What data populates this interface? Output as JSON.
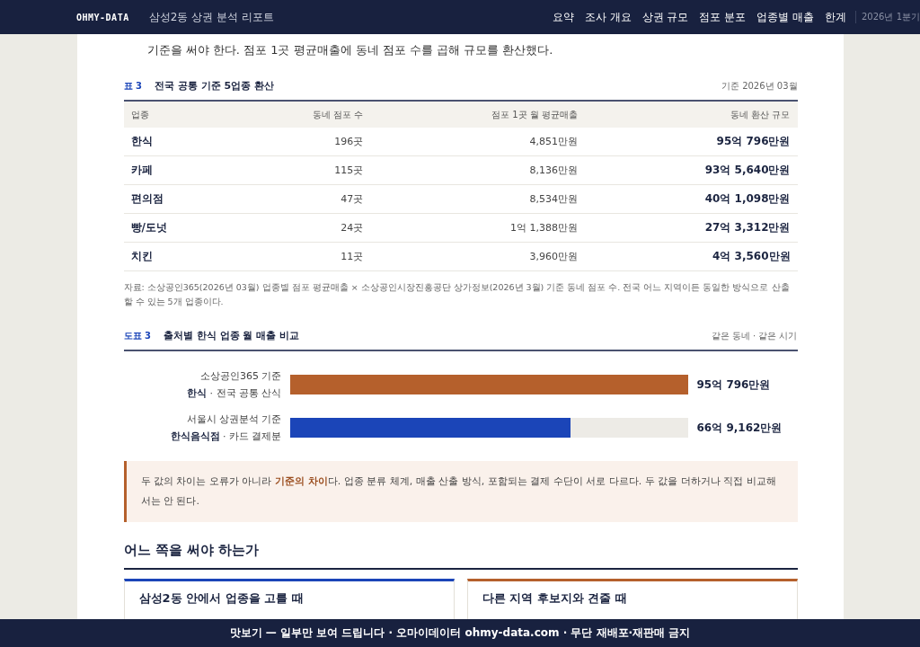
{
  "header": {
    "logo": "OHMY-DATA",
    "title": "삼성2동 상권 분석 리포트",
    "nav": [
      {
        "label": "요약",
        "selected": false
      },
      {
        "label": "조사 개요",
        "selected": false
      },
      {
        "label": "상권 규모",
        "selected": false
      },
      {
        "label": "점포 분포",
        "selected": false
      },
      {
        "label": "업종별 매출",
        "selected": false
      },
      {
        "label": "한계",
        "selected": false
      }
    ],
    "period": "2026년 1분기"
  },
  "intro": "기준을 써야 한다. 점포 1곳 평균매출에 동네 점포 수를 곱해 규모를 환산했다.",
  "table": {
    "tag": "표 3",
    "title": "전국 공통 기준 5업종 환산",
    "meta": "기준 2026년 03월",
    "columns": [
      "업종",
      "동네 점포 수",
      "점포 1곳 월 평균매출",
      "동네 환산 규모"
    ],
    "rows": [
      [
        "한식",
        "196곳",
        "4,851만원",
        "95억 796만원"
      ],
      [
        "카페",
        "115곳",
        "8,136만원",
        "93억 5,640만원"
      ],
      [
        "편의점",
        "47곳",
        "8,534만원",
        "40억 1,098만원"
      ],
      [
        "빵/도넛",
        "24곳",
        "1억 1,388만원",
        "27억 3,312만원"
      ],
      [
        "치킨",
        "11곳",
        "3,960만원",
        "4억 3,560만원"
      ]
    ],
    "note": "자료: 소상공인365(2026년 03월) 업종별 점포 평균매출 × 소상공인시장진흥공단 상가정보(2026년 3월) 기준 동네 점포 수. 전국 어느 지역이든 동일한 방식으로 산출할 수 있는 5개 업종이다."
  },
  "figure": {
    "tag": "도표 3",
    "title": "출처별 한식 업종 월 매출 비교",
    "meta": "같은 동네 · 같은 시기",
    "bars": [
      {
        "source": "소상공인365 기준",
        "label": "**한식** · 전국 공통 산식",
        "level": 1.0,
        "color": "#b5602c",
        "value": "95억 796만원"
      },
      {
        "source": "서울시 상권분석 기준",
        "label": "**한식음식점** · 카드 결제분",
        "level": 0.705,
        "color": "#1b45b8",
        "value": "66억 9,162만원"
      }
    ]
  },
  "callout": "두 값의 차이는 오류가 아니라 **기준의 차이**다. 업종 분류 체계, 매출 산출 방식, 포함되는 결제 수단이 서로 다르다. 두 값을 더하거나 직접 비교해서는 안 된다.",
  "section": {
    "heading": "어느 쪽을 써야 하는가",
    "cards": [
      {
        "title": "삼성2동 안에서 업종을 고를 때",
        "color": "#1b45b8"
      },
      {
        "title": "다른 지역 후보지와 견줄 때",
        "color": "#b5602c"
      }
    ]
  },
  "footer": "맛보기 — 일부만 보여 드립니다 · 오마이데이터 ohmy-data.com · 무단 재배포·재판매 금지"
}
